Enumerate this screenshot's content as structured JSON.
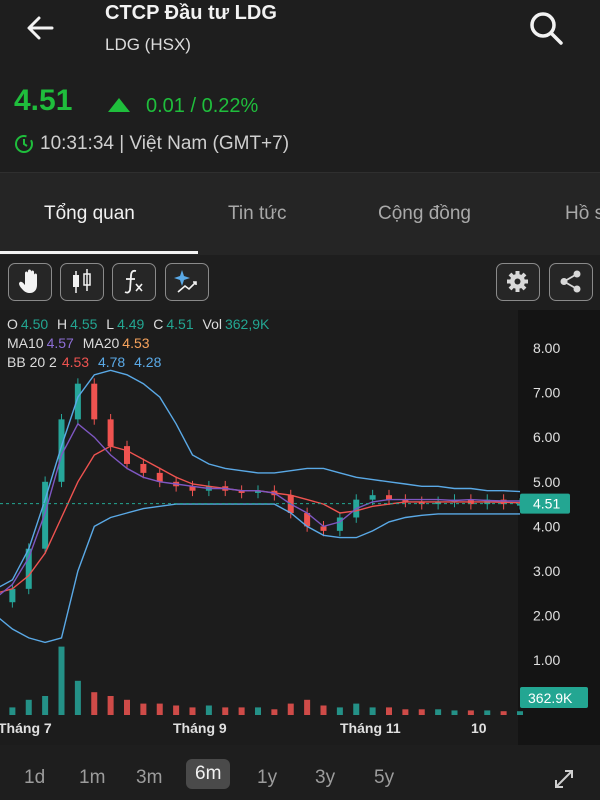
{
  "header": {
    "title": "CTCP Đầu tư LDG",
    "ticker": "LDG (HSX)",
    "price": "4.51",
    "change": "0.01 / 0.22%",
    "time": "10:31:34 | Việt Nam (GMT+7)"
  },
  "tabs": [
    "Tổng quan",
    "Tin tức",
    "Cộng đồng",
    "Hồ s"
  ],
  "toolbar": {
    "buttons": [
      "hand-icon",
      "candlestick-icon",
      "function-icon",
      "sparkle-chart-icon"
    ],
    "right_buttons": [
      "gear-icon",
      "share-icon"
    ]
  },
  "legend": {
    "ohlc": {
      "o_label": "O",
      "o": "4.50",
      "h_label": "H",
      "h": "4.55",
      "l_label": "L",
      "l": "4.49",
      "c_label": "C",
      "c": "4.51",
      "vol_label": "Vol",
      "vol": "362,9K"
    },
    "ma": {
      "ma10_label": "MA10",
      "ma10": "4.57",
      "ma20_label": "MA20",
      "ma20": "4.53"
    },
    "bb": {
      "label": "BB 20 2",
      "mid": "4.53",
      "upper": "4.78",
      "lower": "4.28"
    }
  },
  "chart_data": {
    "type": "line",
    "title": "",
    "y_ticks": [
      "8.00",
      "7.00",
      "6.00",
      "5.00",
      "4.00",
      "3.00",
      "2.00",
      "1.00"
    ],
    "ylim": [
      0,
      8.6
    ],
    "x_ticks": [
      "Tháng 7",
      "Tháng 9",
      "Tháng 11",
      "10"
    ],
    "current_price_label": "4.51",
    "volume_label": "362.9K",
    "series": [
      {
        "name": "BB 20 2",
        "values": [
          2.6,
          2.8,
          3.5,
          4.6,
          5.8,
          6.9,
          7.4,
          7.5,
          7.4,
          7.2,
          6.9,
          6.3,
          5.6,
          5.4,
          5.3,
          5.25,
          5.2,
          5.2,
          5.25,
          5.3,
          5.3,
          5.2,
          5.1,
          5.05,
          5.0,
          4.95,
          4.9,
          4.9,
          4.85,
          4.85,
          4.8,
          4.8,
          4.78
        ]
      },
      {
        "name": "MA20",
        "values": [
          2.5,
          2.6,
          2.9,
          3.4,
          4.2,
          5.0,
          5.6,
          5.8,
          5.7,
          5.5,
          5.3,
          5.1,
          4.95,
          4.9,
          4.85,
          4.8,
          4.8,
          4.75,
          4.7,
          4.6,
          4.5,
          4.3,
          4.35,
          4.45,
          4.5,
          4.55,
          4.55,
          4.55,
          4.55,
          4.55,
          4.55,
          4.54,
          4.53
        ]
      },
      {
        "name": "MA10",
        "values": [
          2.4,
          2.7,
          3.3,
          4.3,
          5.6,
          6.3,
          6.0,
          5.6,
          5.3,
          5.1,
          5.0,
          4.95,
          4.9,
          4.85,
          4.85,
          4.8,
          4.8,
          4.75,
          4.5,
          4.3,
          4.0,
          4.1,
          4.4,
          4.55,
          4.6,
          4.6,
          4.6,
          4.6,
          4.58,
          4.6,
          4.58,
          4.57,
          4.57
        ]
      },
      {
        "name": "BB 20 2 lower",
        "values": [
          2.0,
          1.7,
          1.5,
          1.4,
          1.5,
          3.0,
          4.0,
          4.2,
          4.3,
          4.4,
          4.45,
          4.5,
          4.5,
          4.5,
          4.5,
          4.5,
          4.5,
          4.5,
          4.3,
          4.0,
          3.8,
          3.75,
          3.75,
          3.9,
          4.1,
          4.2,
          4.25,
          4.28,
          4.28,
          4.28,
          4.28,
          4.28,
          4.28
        ]
      },
      {
        "name": "Close",
        "values": [
          2.3,
          2.6,
          3.5,
          5.0,
          6.4,
          7.2,
          6.4,
          5.8,
          5.4,
          5.2,
          5.0,
          4.9,
          4.8,
          4.9,
          4.8,
          4.75,
          4.8,
          4.7,
          4.3,
          4.0,
          3.9,
          4.2,
          4.6,
          4.7,
          4.6,
          4.55,
          4.5,
          4.55,
          4.6,
          4.5,
          4.6,
          4.5,
          4.51
        ]
      }
    ],
    "volume": [
      0.3,
      0.2,
      0.4,
      0.5,
      1.8,
      0.9,
      0.6,
      0.5,
      0.4,
      0.3,
      0.3,
      0.25,
      0.2,
      0.25,
      0.2,
      0.2,
      0.2,
      0.15,
      0.3,
      0.4,
      0.25,
      0.2,
      0.3,
      0.2,
      0.2,
      0.15,
      0.15,
      0.15,
      0.12,
      0.12,
      0.12,
      0.1,
      0.1
    ]
  },
  "timeframes": [
    "1d",
    "1m",
    "3m",
    "6m",
    "1y",
    "3y",
    "5y"
  ],
  "timeframe_active": "6m",
  "colors": {
    "up": "#1fbe3c",
    "candle_up": "#26a69a",
    "candle_down": "#ef5350",
    "ma10": "#7e57c2",
    "ma20": "#f7a35c",
    "bb": "#5aa9e6",
    "accent_teal": "#23a692"
  }
}
